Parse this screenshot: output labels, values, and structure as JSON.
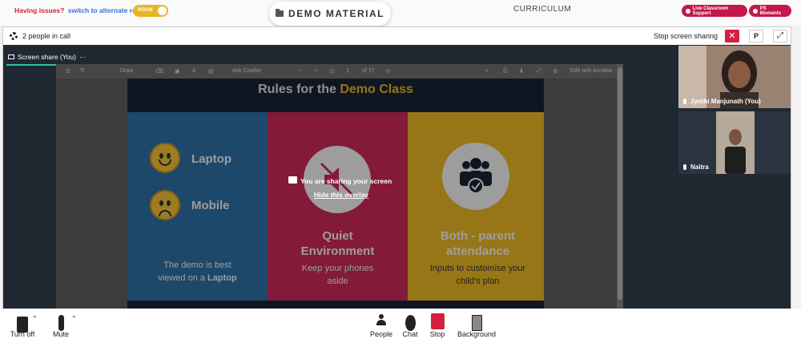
{
  "topbar": {
    "issues_question": "Having issues?",
    "alternate_room_link": "switch to alternate room",
    "room_toggle_label": "ROOM",
    "demo_material": "DEMO MATERIAL",
    "curriculum": "CURRICULUM",
    "live_support": "Live Classroom Support",
    "ps_moments": "PS Moments"
  },
  "call": {
    "people_count": "2 people in call",
    "stop_sharing": "Stop screen sharing",
    "stop_x": "✕",
    "p_button": "P",
    "expand": "⤢"
  },
  "tab": {
    "label": "Screen share (You)",
    "more": "···"
  },
  "doc_toolbar": {
    "draw": "Draw",
    "ask": "Ask Copilot",
    "page_num": "1",
    "page_of": "of 77",
    "edit": "Edit with Acrobat"
  },
  "slide": {
    "title_prefix": "Rules for the ",
    "title_accent": "Demo Class",
    "laptop": "Laptop",
    "mobile": "Mobile",
    "demo_note_line1": "The demo is best",
    "demo_note_line2": "viewed on a ",
    "demo_note_bold": "Laptop",
    "quiet_line1": "Quiet",
    "quiet_line2": "Environment",
    "quiet_caption_line1": "Keep your phones",
    "quiet_caption_line2": "aside",
    "parent_line1": "Both - parent",
    "parent_line2": "attendance",
    "parent_caption_line1": "Inputs to customise your",
    "parent_caption_line2": "child's plan"
  },
  "overlay": {
    "message": "You are sharing your screen",
    "hide": "Hide this overlay"
  },
  "participants": [
    {
      "name": "Jyothi Manjunath (You)"
    },
    {
      "name": "Naitra"
    }
  ],
  "controls": {
    "turn_off": "Turn off",
    "mute": "Mute",
    "people": "People",
    "chat": "Chat",
    "stop": "Stop",
    "background": "Background"
  },
  "colors": {
    "accent_yellow": "#e8b624",
    "alert_red": "#d32040",
    "brand_magenta": "#c2184b",
    "tab_underline": "#2ec4a8"
  }
}
